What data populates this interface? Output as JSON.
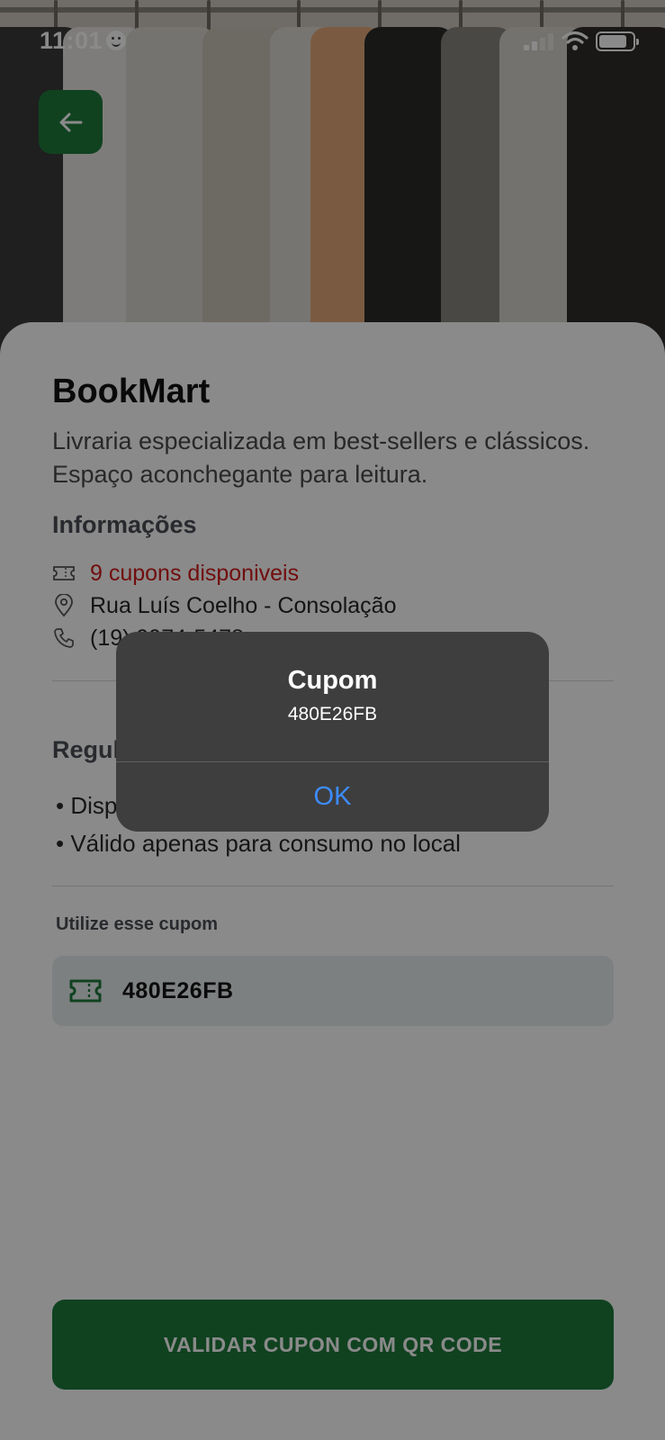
{
  "status_bar": {
    "time": "11:01"
  },
  "header": {
    "back_icon": "arrow-left-icon"
  },
  "store": {
    "name": "BookMart",
    "description": "Livraria especializada em best-sellers e clássicos. Espaço aconchegante para leitura."
  },
  "info": {
    "heading": "Informações",
    "coupons": "9 cupons disponiveis",
    "address": "Rua Luís Coelho - Consolação",
    "phone": "(19) 9974-5478"
  },
  "rules": {
    "heading": "Regulamento",
    "items": [
      "• Disponível até 31/12/24",
      "• Válido apenas para consumo no local"
    ]
  },
  "coupon": {
    "label": "Utilize esse cupom",
    "code": "480E26FB"
  },
  "validate_button": {
    "label": "VALIDAR CUPON COM QR CODE"
  },
  "alert": {
    "title": "Cupom",
    "message": "480E26FB",
    "ok_label": "OK"
  },
  "colors": {
    "brand_green": "#1e7a3c",
    "alert_blue": "#3d8cff",
    "coupon_red": "#d11a1a"
  }
}
